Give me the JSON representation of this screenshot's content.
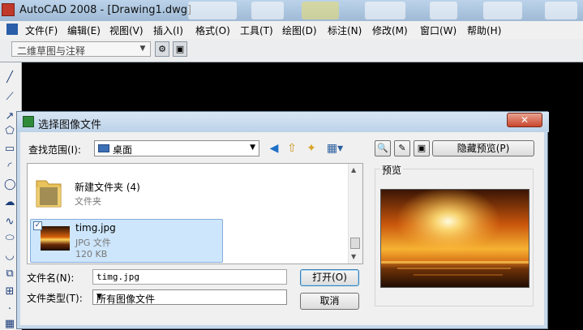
{
  "app": {
    "title": "AutoCAD 2008 - [Drawing1.dwg]"
  },
  "menu": {
    "items": [
      "文件(F)",
      "编辑(E)",
      "视图(V)",
      "插入(I)",
      "格式(O)",
      "工具(T)",
      "绘图(D)",
      "标注(N)",
      "修改(M)",
      "窗口(W)",
      "帮助(H)"
    ]
  },
  "toolbar": {
    "workspace": "二维草图与注释"
  },
  "dialog": {
    "title": "选择图像文件",
    "close": "✕",
    "lookin_label": "查找范围(I):",
    "lookin_value": "桌面",
    "hide_preview": "隐藏预览(P)",
    "preview_label": "预览",
    "items": [
      {
        "name": "新建文件夹 (4)",
        "type": "文件夹"
      },
      {
        "name": "timg.jpg",
        "type": "JPG 文件",
        "size": "120 KB"
      }
    ],
    "filename_label": "文件名(N):",
    "filename_value": "timg.jpg",
    "filetype_label": "文件类型(T):",
    "filetype_value": "所有图像文件",
    "open": "打开(O)",
    "cancel": "取消"
  },
  "colors": {
    "drawing_area": "#000000",
    "selection": "#cde6fb",
    "title_bar": "#bcd3ea"
  }
}
